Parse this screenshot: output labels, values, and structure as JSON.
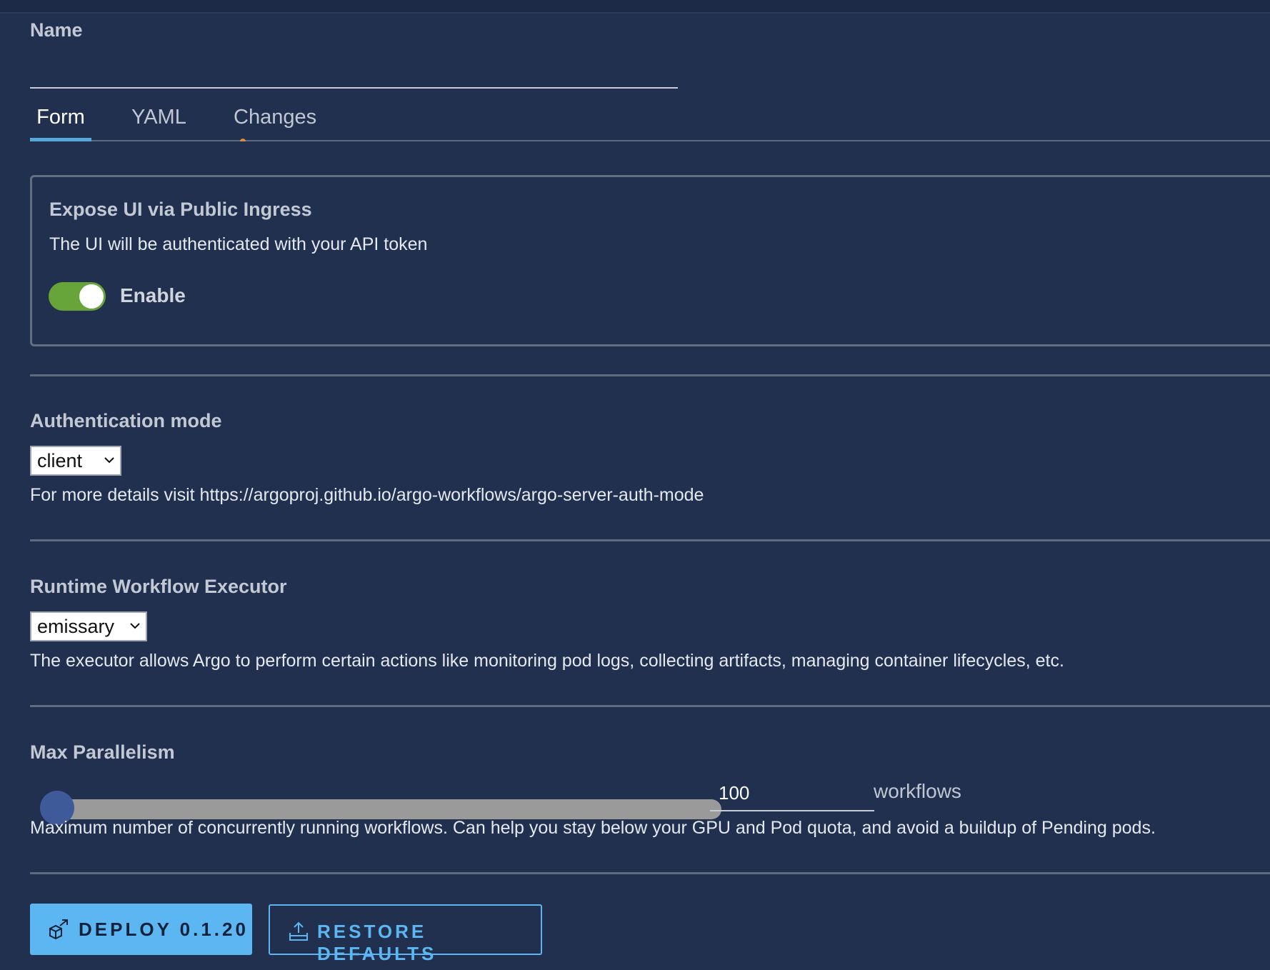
{
  "name_field": {
    "label": "Name",
    "value": ""
  },
  "tabs": [
    {
      "label": "Form",
      "active": true
    },
    {
      "label": "YAML",
      "active": false
    },
    {
      "label": "Changes",
      "active": false
    }
  ],
  "ingress_card": {
    "title": "Expose UI via Public Ingress",
    "description": "The UI will be authenticated with your API token",
    "toggle_label": "Enable",
    "toggle_on": true
  },
  "auth_mode": {
    "title": "Authentication mode",
    "selected": "client",
    "help": "For more details visit https://argoproj.github.io/argo-workflows/argo-server-auth-mode"
  },
  "executor": {
    "title": "Runtime Workflow Executor",
    "selected": "emissary",
    "help": "The executor allows Argo to perform certain actions like monitoring pod logs, collecting artifacts, managing container lifecycles, etc."
  },
  "parallelism": {
    "title": "Max Parallelism",
    "value": "100",
    "unit": "workflows",
    "help": "Maximum number of concurrently running workflows. Can help you stay below your GPU and Pod quota, and avoid a buildup of Pending pods."
  },
  "actions": {
    "deploy_label": "DEPLOY 0.1.20",
    "restore_label": "RESTORE DEFAULTS"
  },
  "colors": {
    "background": "#22304f",
    "accent": "#5bb6f2",
    "toggle_on": "#67a53a",
    "tab_indicator": "#59a8dc"
  }
}
